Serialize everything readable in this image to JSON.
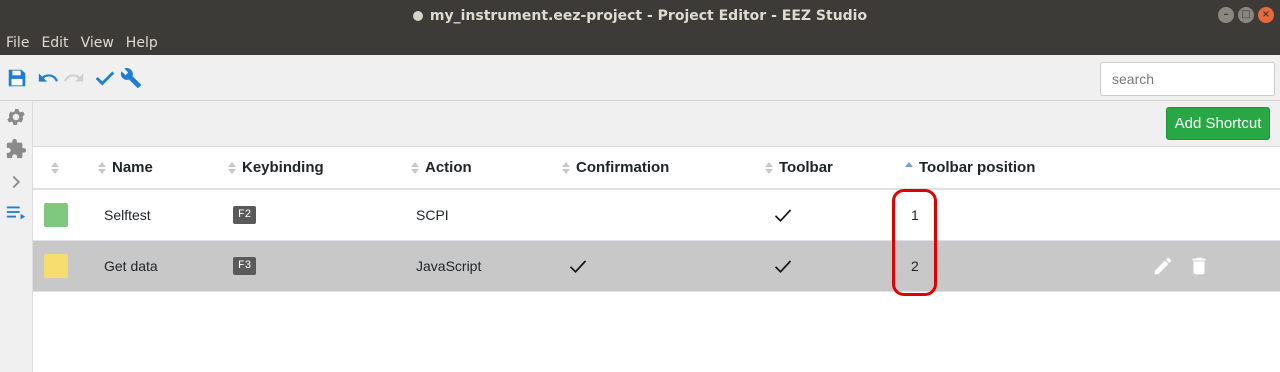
{
  "window": {
    "title": "my_instrument.eez-project - Project Editor - EEZ Studio"
  },
  "menu": [
    "File",
    "Edit",
    "View",
    "Help"
  ],
  "toolbar": {
    "icons": [
      "save-icon",
      "undo-icon",
      "redo-icon",
      "check-icon",
      "wrench-icon"
    ],
    "search_placeholder": "search"
  },
  "leftrail": {
    "icons": [
      "gear-icon",
      "puzzle-icon",
      "chevron-right-icon",
      "list-arrow-icon"
    ]
  },
  "actions": {
    "add_shortcut_label": "Add Shortcut"
  },
  "table": {
    "columns": [
      "",
      "Name",
      "Keybinding",
      "Action",
      "Confirmation",
      "Toolbar",
      "Toolbar position"
    ],
    "sorted_column": "Toolbar position",
    "rows": [
      {
        "color": "#7fc97f",
        "name": "Selftest",
        "keybinding": "F2",
        "action": "SCPI",
        "confirmation": false,
        "toolbar": true,
        "toolbar_position": "1",
        "selected": false
      },
      {
        "color": "#f7dc6f",
        "name": "Get data",
        "keybinding": "F3",
        "action": "JavaScript",
        "confirmation": true,
        "toolbar": true,
        "toolbar_position": "2",
        "selected": true
      }
    ]
  },
  "colors": {
    "accent": "#1c7ed6",
    "add_button": "#28a745",
    "highlight": "#e00000"
  }
}
